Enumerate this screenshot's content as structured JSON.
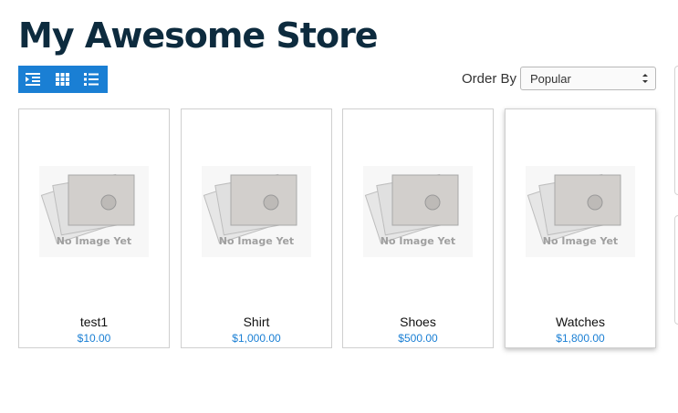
{
  "header": {
    "title": "My Awesome Store"
  },
  "toolbar": {
    "view_icons": [
      "indent-list-icon",
      "grid-icon",
      "list-icon"
    ],
    "order_by_label": "Order By",
    "order_by_selected": "Popular"
  },
  "colors": {
    "accent": "#1a7fd4",
    "title": "#0d2b3e"
  },
  "products": [
    {
      "name": "test1",
      "price": "$10.00",
      "image_text": "No Image Yet"
    },
    {
      "name": "Shirt",
      "price": "$1,000.00",
      "image_text": "No Image Yet"
    },
    {
      "name": "Shoes",
      "price": "$500.00",
      "image_text": "No Image Yet"
    },
    {
      "name": "Watches",
      "price": "$1,800.00",
      "image_text": "No Image Yet"
    }
  ]
}
